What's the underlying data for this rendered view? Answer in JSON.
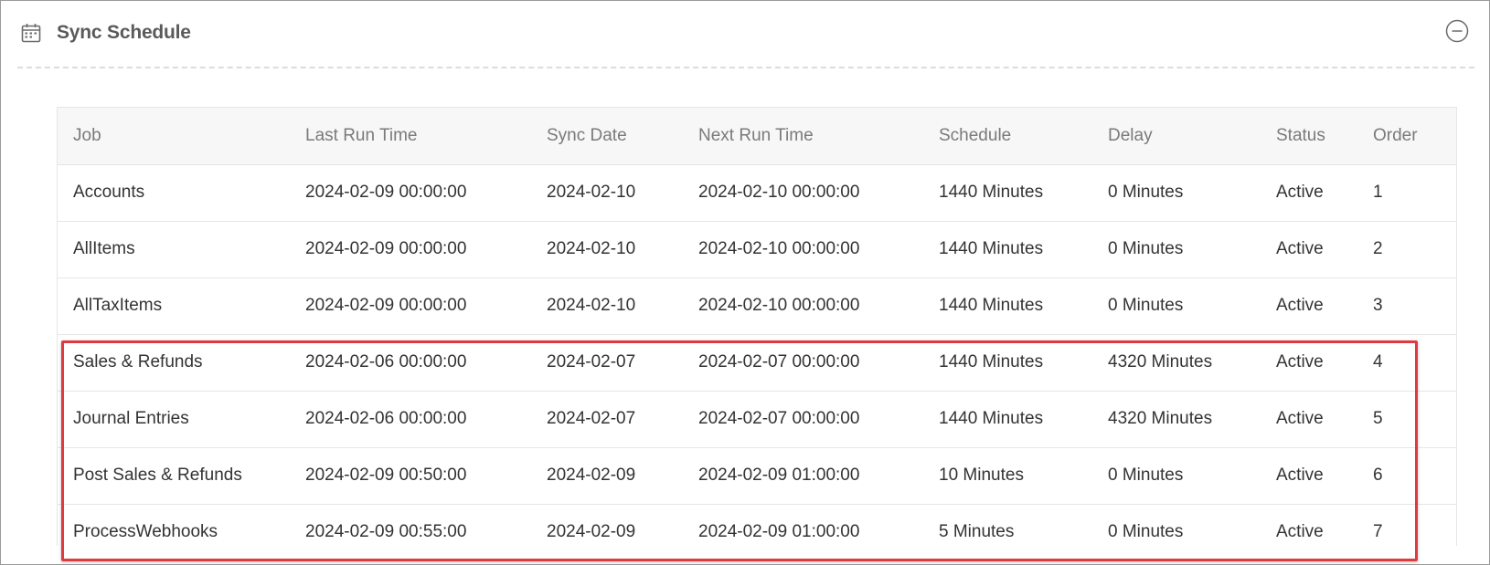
{
  "panel": {
    "title": "Sync Schedule",
    "title_icon": "calendar-icon",
    "collapse_icon": "minus-circle-icon"
  },
  "table": {
    "headers": [
      "Job",
      "Last Run Time",
      "Sync Date",
      "Next Run Time",
      "Schedule",
      "Delay",
      "Status",
      "Order"
    ],
    "rows": [
      [
        "Accounts",
        "2024-02-09 00:00:00",
        "2024-02-10",
        "2024-02-10 00:00:00",
        "1440 Minutes",
        "0 Minutes",
        "Active",
        "1"
      ],
      [
        "AllItems",
        "2024-02-09 00:00:00",
        "2024-02-10",
        "2024-02-10 00:00:00",
        "1440 Minutes",
        "0 Minutes",
        "Active",
        "2"
      ],
      [
        "AllTaxItems",
        "2024-02-09 00:00:00",
        "2024-02-10",
        "2024-02-10 00:00:00",
        "1440 Minutes",
        "0 Minutes",
        "Active",
        "3"
      ],
      [
        "Sales & Refunds",
        "2024-02-06 00:00:00",
        "2024-02-07",
        "2024-02-07 00:00:00",
        "1440 Minutes",
        "4320 Minutes",
        "Active",
        "4"
      ],
      [
        "Journal Entries",
        "2024-02-06 00:00:00",
        "2024-02-07",
        "2024-02-07 00:00:00",
        "1440 Minutes",
        "4320 Minutes",
        "Active",
        "5"
      ],
      [
        "Post Sales & Refunds",
        "2024-02-09 00:50:00",
        "2024-02-09",
        "2024-02-09 01:00:00",
        "10 Minutes",
        "0 Minutes",
        "Active",
        "6"
      ],
      [
        "ProcessWebhooks",
        "2024-02-09 00:55:00",
        "2024-02-09",
        "2024-02-09 01:00:00",
        "5 Minutes",
        "0 Minutes",
        "Active",
        "7"
      ]
    ]
  },
  "colors": {
    "highlight_border": "#e0393e",
    "header_bg": "#f7f7f7",
    "title_color": "#5a5a5a"
  }
}
